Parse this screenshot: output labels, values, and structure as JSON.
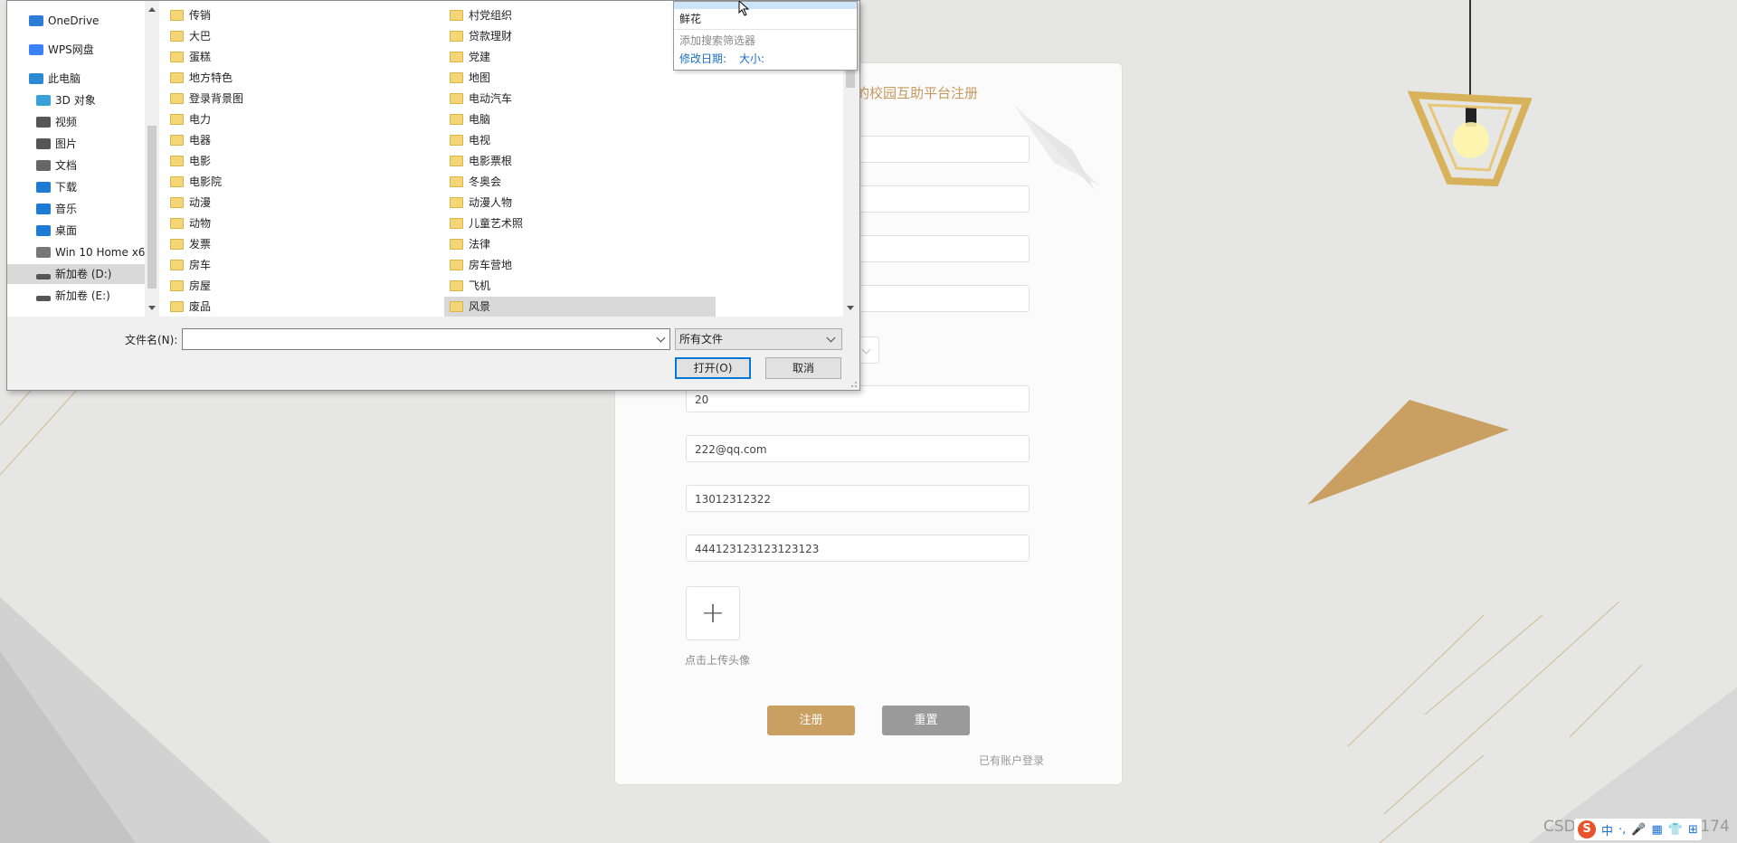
{
  "registration": {
    "title": "的校园互助平台注册",
    "fields": [
      {
        "value": ""
      },
      {
        "value": ""
      },
      {
        "value": ""
      },
      {
        "value": ""
      },
      {
        "value": "20"
      },
      {
        "value": "222@qq.com"
      },
      {
        "value": "13012312322"
      },
      {
        "value": "444123123123123123"
      }
    ],
    "upload_hint": "点击上传头像",
    "register_label": "注册",
    "reset_label": "重置",
    "login_link": "已有账户登录"
  },
  "file_dialog": {
    "nav_items": [
      {
        "label": "OneDrive",
        "icon": "cloud-icon",
        "color": "#2b7cd3"
      },
      {
        "label": "WPS网盘",
        "icon": "cloud-icon",
        "color": "#3b82f6"
      },
      {
        "label": "此电脑",
        "icon": "computer-icon",
        "color": "#2a8ad4"
      },
      {
        "label": "3D 对象",
        "icon": "cube-icon",
        "color": "#39a0d8"
      },
      {
        "label": "视频",
        "icon": "video-icon",
        "color": "#555555"
      },
      {
        "label": "图片",
        "icon": "image-icon",
        "color": "#555555"
      },
      {
        "label": "文档",
        "icon": "document-icon",
        "color": "#666666"
      },
      {
        "label": "下载",
        "icon": "download-icon",
        "color": "#1f7ad6"
      },
      {
        "label": "音乐",
        "icon": "music-icon",
        "color": "#1f7ad6"
      },
      {
        "label": "桌面",
        "icon": "desktop-icon",
        "color": "#1f7ad6"
      },
      {
        "label": "Win 10 Home x6",
        "icon": "drive-icon",
        "color": "#777777"
      },
      {
        "label": "新加卷 (D:)",
        "icon": "drive-icon",
        "color": "#555555"
      },
      {
        "label": "新加卷 (E:)",
        "icon": "drive-icon",
        "color": "#555555"
      }
    ],
    "files_col1": [
      "传销",
      "大巴",
      "蛋糕",
      "地方特色",
      "登录背景图",
      "电力",
      "电器",
      "电影",
      "电影院",
      "动漫",
      "动物",
      "发票",
      "房车",
      "房屋",
      "废品"
    ],
    "files_col2": [
      "村党组织",
      "贷款理财",
      "党建",
      "地图",
      "电动汽车",
      "电脑",
      "电视",
      "电影票根",
      "冬奥会",
      "动漫人物",
      "儿童艺术照",
      "法律",
      "房车营地",
      "飞机",
      "风景"
    ],
    "dropdown": {
      "item": "鲜花",
      "add_filter": "添加搜索筛选器",
      "modified_date": "修改日期:",
      "size": "大小:"
    },
    "filename_label": "文件名(N):",
    "filename_value": "",
    "file_type": "所有文件",
    "open_label": "打开(O)",
    "cancel_label": "取消"
  },
  "watermark": "CSDN @QQ3359892174",
  "ime": {
    "logo": "S",
    "items": [
      "中",
      "·,",
      "🎤",
      "▦",
      "👕",
      "⊞"
    ]
  },
  "colors": {
    "accent": "#c9a062",
    "reset": "#9a9a9a",
    "selection": "#d9d9d9",
    "link": "#1a6ec0"
  }
}
